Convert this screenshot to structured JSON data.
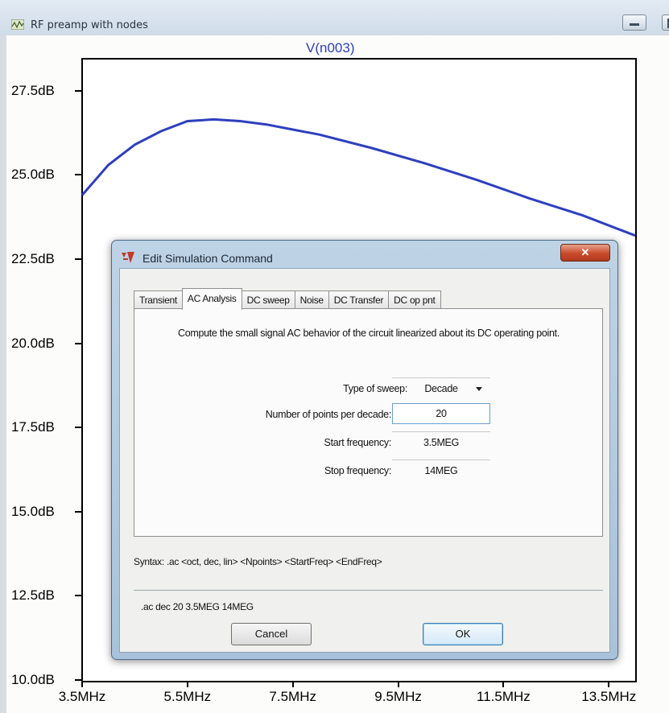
{
  "window": {
    "title": "RF preamp with nodes",
    "minimize_icon": "minimize-icon",
    "restore_icon": "restore-icon"
  },
  "plot": {
    "trace_title": "V(n003)",
    "trace_color": "#2e3fbf"
  },
  "chart_data": {
    "type": "line",
    "title": "V(n003)",
    "xlabel": "",
    "ylabel": "",
    "x_ticks": [
      "3.5MHz",
      "5.5MHz",
      "7.5MHz",
      "9.5MHz",
      "11.5MHz",
      "13.5MHz"
    ],
    "y_ticks": [
      "27.5dB",
      "25.0dB",
      "22.5dB",
      "20.0dB",
      "17.5dB",
      "15.0dB",
      "12.5dB",
      "10.0dB"
    ],
    "xlim": [
      3.5,
      14.0
    ],
    "ylim": [
      10.0,
      28.5
    ],
    "x_unit": "MHz",
    "y_unit": "dB",
    "grid": false,
    "series": [
      {
        "x": [
          3.5,
          4.0,
          4.5,
          5.0,
          5.5,
          6.0,
          6.5,
          7.0,
          7.5,
          8.0,
          9.0,
          10.0,
          11.0,
          12.0,
          13.0,
          14.0
        ],
        "y": [
          24.4,
          25.3,
          25.9,
          26.3,
          26.6,
          26.65,
          26.6,
          26.5,
          26.35,
          26.2,
          25.8,
          25.35,
          24.85,
          24.3,
          23.8,
          23.2
        ]
      }
    ]
  },
  "dialog": {
    "title": "Edit Simulation Command",
    "close_label": "✕",
    "tabs": [
      {
        "label": "Transient"
      },
      {
        "label": "AC Analysis"
      },
      {
        "label": "DC sweep"
      },
      {
        "label": "Noise"
      },
      {
        "label": "DC Transfer"
      },
      {
        "label": "DC op pnt"
      }
    ],
    "active_tab": "AC Analysis",
    "description": "Compute the small signal AC behavior of the circuit linearized about its DC operating point.",
    "fields": {
      "sweep_type": {
        "label": "Type of sweep:",
        "value": "Decade"
      },
      "points": {
        "label": "Number of points per decade:",
        "value": "20"
      },
      "start": {
        "label": "Start frequency:",
        "value": "3.5MEG"
      },
      "stop": {
        "label": "Stop frequency:",
        "value": "14MEG"
      }
    },
    "syntax": "Syntax:  .ac <oct, dec, lin> <Npoints> <StartFreq> <EndFreq>",
    "command": ".ac dec 20 3.5MEG 14MEG",
    "cancel_label": "Cancel",
    "ok_label": "OK"
  }
}
